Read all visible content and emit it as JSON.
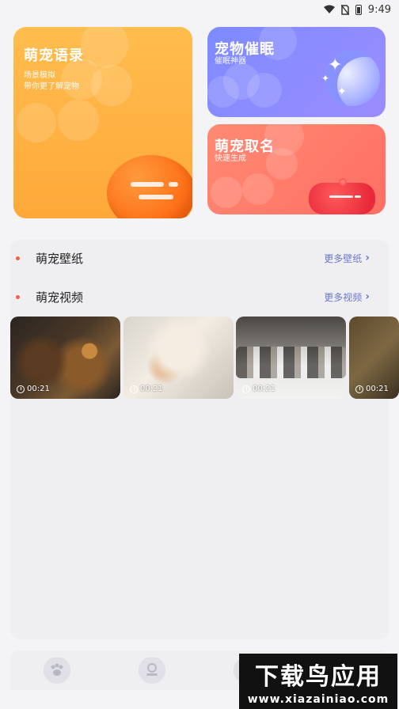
{
  "status_bar": {
    "time": "9:49"
  },
  "cards": {
    "phrases": {
      "title": "萌宠语录",
      "sub1": "场景模拟",
      "sub2": "带你更了解宠物"
    },
    "sleep": {
      "title": "宠物催眠",
      "sub": "催眠神器"
    },
    "naming": {
      "title": "萌宠取名",
      "sub": "快速生成"
    }
  },
  "sections": {
    "wallpaper": {
      "label": "萌宠壁纸",
      "more": "更多壁纸"
    },
    "video": {
      "label": "萌宠视频",
      "more": "更多视频"
    }
  },
  "videos": [
    {
      "duration": "00:21"
    },
    {
      "duration": "00:21"
    },
    {
      "duration": "00:21"
    },
    {
      "duration": "00:21"
    }
  ],
  "watermark": {
    "main": "下载鸟应用",
    "url": "www.xiazainiao.com"
  },
  "colors": {
    "accent": "#6b78c8",
    "dot": "#ef5e4e",
    "orange": "#ffa83a",
    "purple": "#8c8bff",
    "coral": "#ff7a6b"
  }
}
